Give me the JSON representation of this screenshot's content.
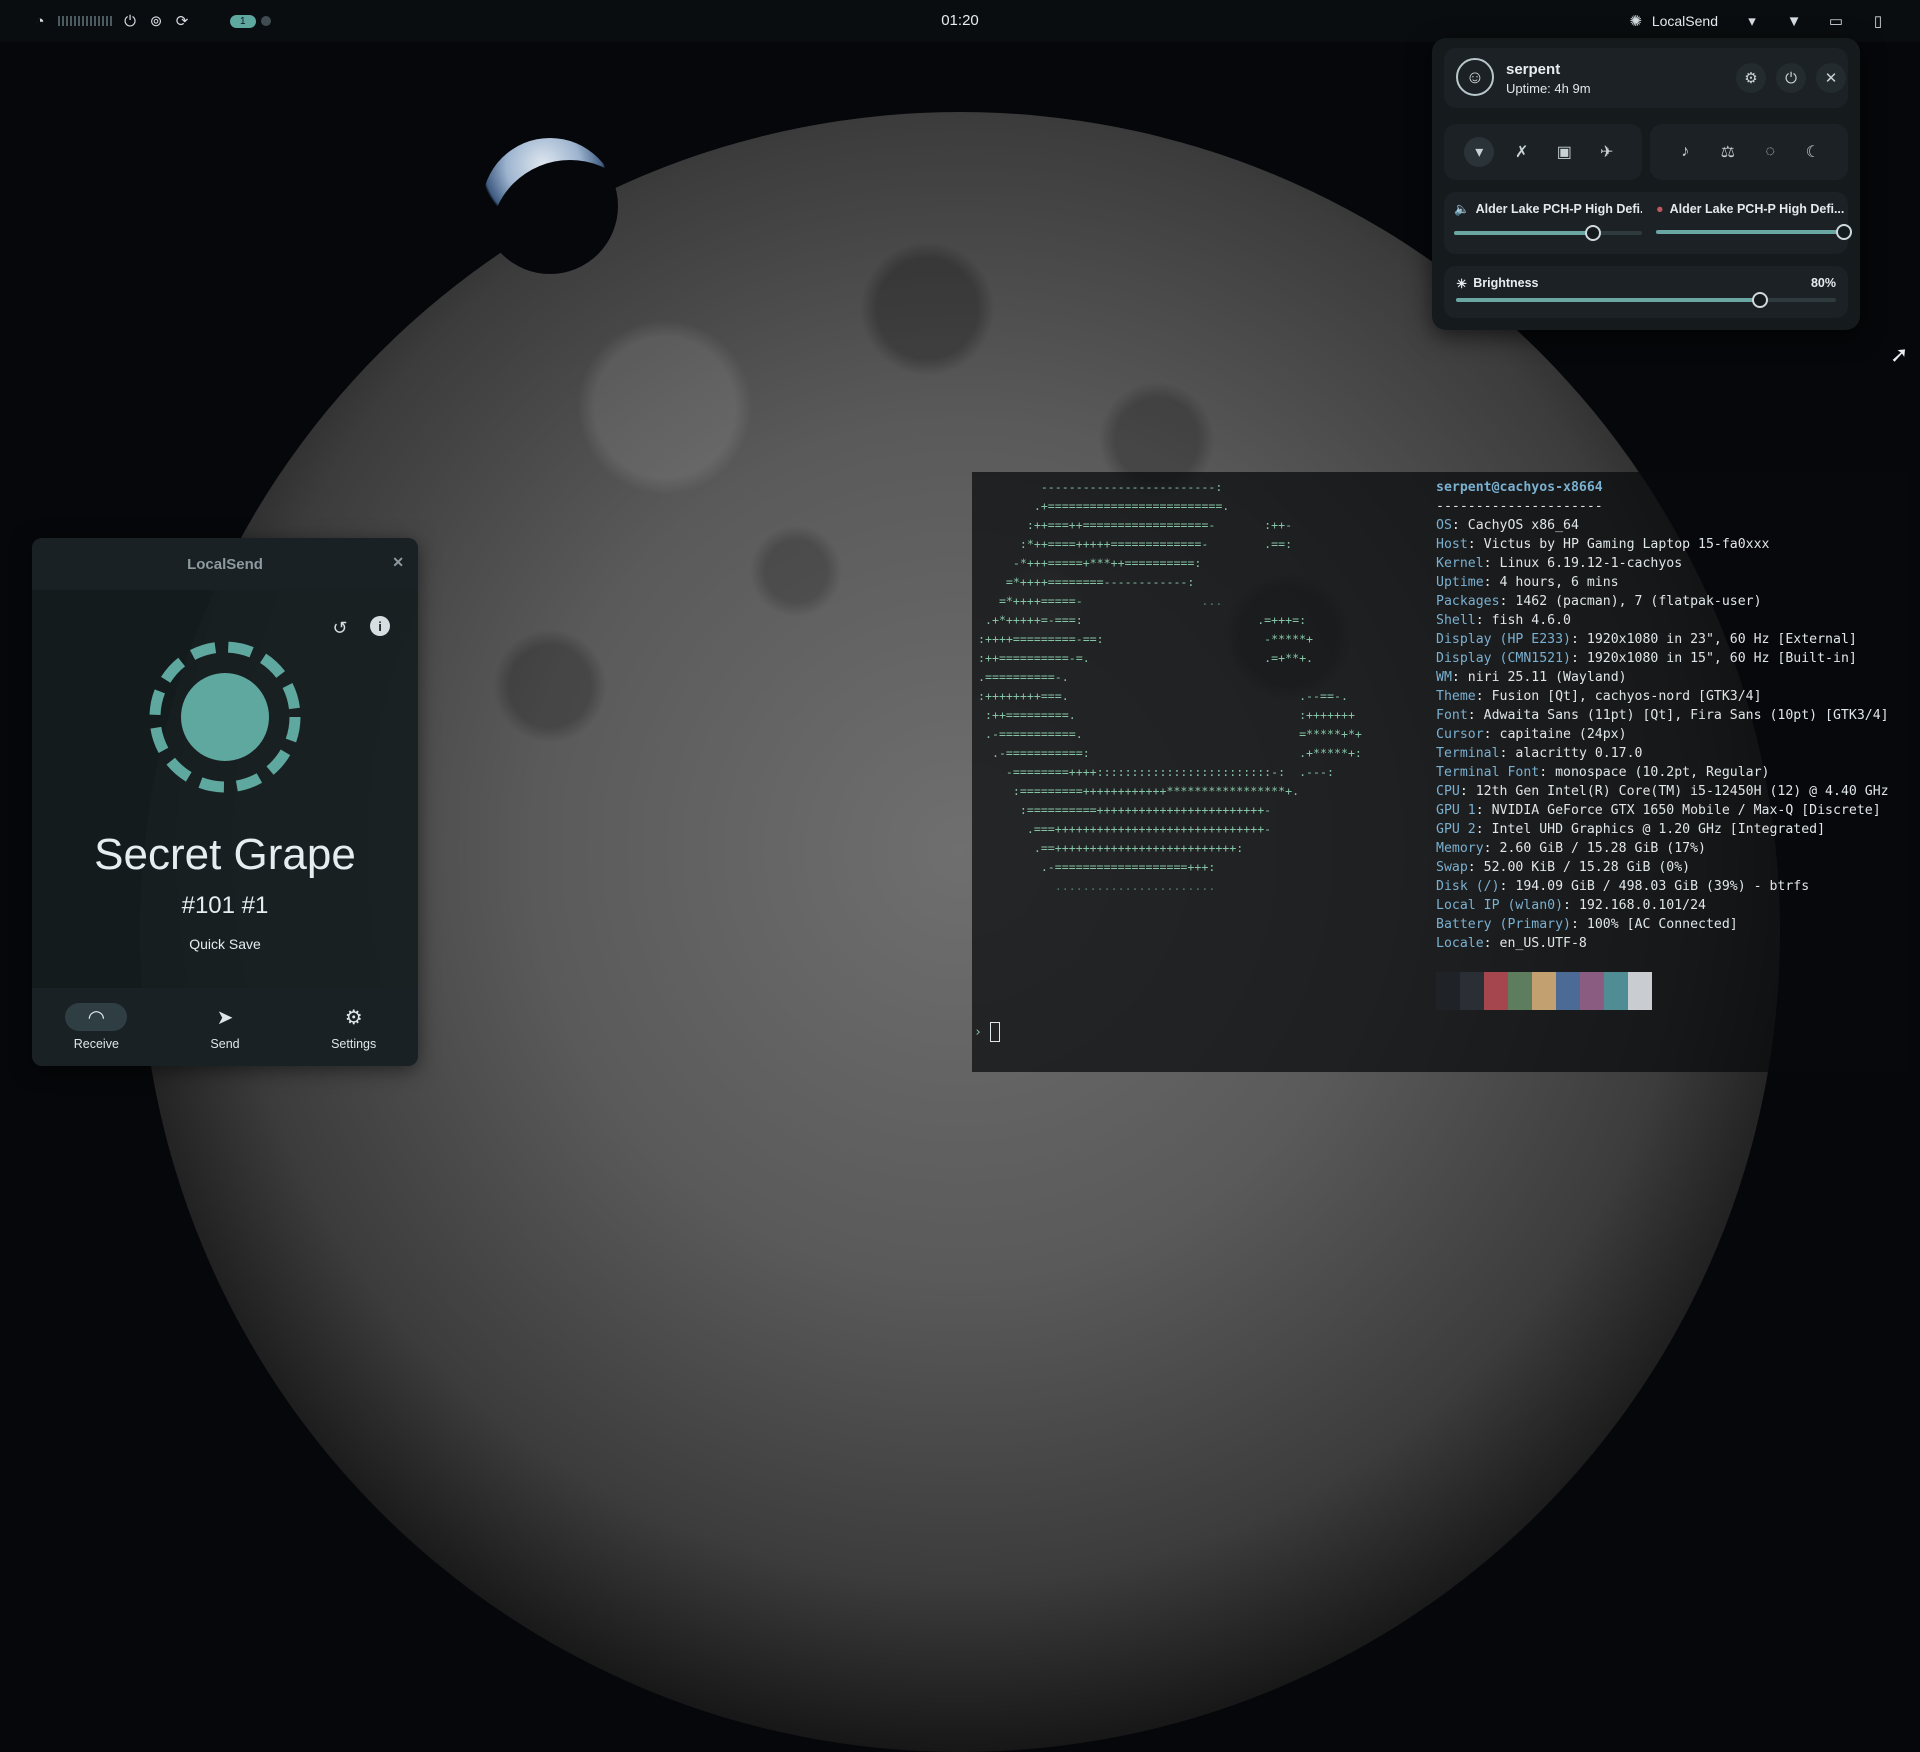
{
  "topbar": {
    "workspace_active": "1",
    "clock": "01:20",
    "tray_app_label": "LocalSend"
  },
  "quick_settings": {
    "user": {
      "name": "serpent",
      "uptime": "Uptime: 4h 9m"
    },
    "audio": [
      {
        "label": "Alder Lake PCH-P High Defi...",
        "level": 0.74
      },
      {
        "label": "Alder Lake PCH-P High Defi...",
        "level": 1.0
      }
    ],
    "brightness": {
      "label": "Brightness",
      "value_text": "80%",
      "level": 0.8
    }
  },
  "localsend": {
    "window_title": "LocalSend",
    "device_name": "Secret Grape",
    "device_code": "#101 #1",
    "quick_save_label": "Quick Save",
    "nav": [
      {
        "label": "Receive",
        "icon": "wifi-icon"
      },
      {
        "label": "Send",
        "icon": "send-icon"
      },
      {
        "label": "Settings",
        "icon": "gear-icon"
      }
    ],
    "accent": "#5fa8a0"
  },
  "terminal": {
    "header": "serpent@cachyos-x8664",
    "separator": "---------------------",
    "info": [
      {
        "key": "OS",
        "value": "CachyOS x86_64"
      },
      {
        "key": "Host",
        "value": "Victus by HP Gaming Laptop 15-fa0xxx"
      },
      {
        "key": "Kernel",
        "value": "Linux 6.19.12-1-cachyos"
      },
      {
        "key": "Uptime",
        "value": "4 hours, 6 mins"
      },
      {
        "key": "Packages",
        "value": "1462 (pacman), 7 (flatpak-user)"
      },
      {
        "key": "Shell",
        "value": "fish 4.6.0"
      },
      {
        "key": "Display (HP E233)",
        "value": "1920x1080 in 23\", 60 Hz [External]"
      },
      {
        "key": "Display (CMN1521)",
        "value": "1920x1080 in 15\", 60 Hz [Built-in]"
      },
      {
        "key": "WM",
        "value": "niri 25.11 (Wayland)"
      },
      {
        "key": "Theme",
        "value": "Fusion [Qt], cachyos-nord [GTK3/4]"
      },
      {
        "key": "Font",
        "value": "Adwaita Sans (11pt) [Qt], Fira Sans (10pt) [GTK3/4]"
      },
      {
        "key": "Cursor",
        "value": "capitaine (24px)"
      },
      {
        "key": "Terminal",
        "value": "alacritty 0.17.0"
      },
      {
        "key": "Terminal Font",
        "value": "monospace (10.2pt, Regular)"
      },
      {
        "key": "CPU",
        "value": "12th Gen Intel(R) Core(TM) i5-12450H (12) @ 4.40 GHz"
      },
      {
        "key": "GPU 1",
        "value": "NVIDIA GeForce GTX 1650 Mobile / Max-Q [Discrete]"
      },
      {
        "key": "GPU 2",
        "value": "Intel UHD Graphics @ 1.20 GHz [Integrated]"
      },
      {
        "key": "Memory",
        "value": "2.60 GiB / 15.28 GiB (17%)"
      },
      {
        "key": "Swap",
        "value": "52.00 KiB / 15.28 GiB (0%)"
      },
      {
        "key": "Disk (/)",
        "value": "194.09 GiB / 498.03 GiB (39%) - btrfs"
      },
      {
        "key": "Local IP (wlan0)",
        "value": "192.168.0.101/24"
      },
      {
        "key": "Battery (Primary)",
        "value": "100% [AC Connected]"
      },
      {
        "key": "Locale",
        "value": "en_US.UTF-8"
      }
    ],
    "palette": [
      "#1f2227",
      "#2a2e35",
      "#a5464e",
      "#5e7d5e",
      "#c2a070",
      "#4b6a96",
      "#8a5c82",
      "#4f8c94",
      "#c9cdd1"
    ],
    "prompt": "›"
  }
}
